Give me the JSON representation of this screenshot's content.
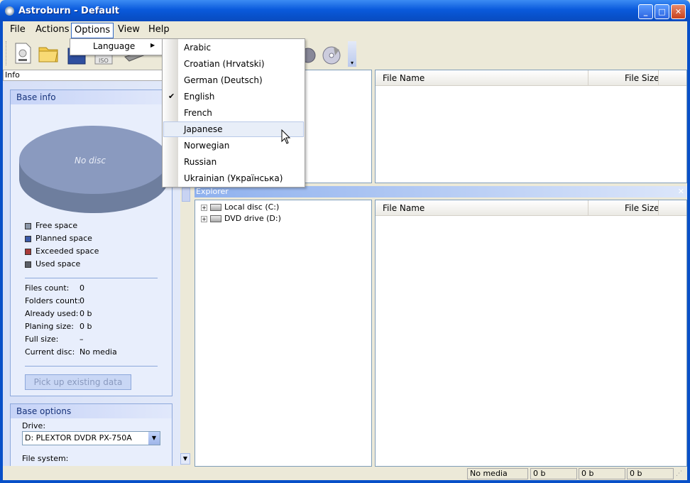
{
  "window": {
    "title": "Astroburn - Default"
  },
  "menubar": [
    "File",
    "Actions",
    "Options",
    "View",
    "Help"
  ],
  "options_menu": {
    "language_label": "Language"
  },
  "language_menu": {
    "items": [
      "Arabic",
      "Croatian (Hrvatski)",
      "German (Deutsch)",
      "English",
      "French",
      "Japanese",
      "Norwegian",
      "Russian",
      "Ukrainian (Українська)"
    ],
    "checked": "English",
    "highlighted": "Japanese"
  },
  "info": {
    "header": "Info",
    "base_info_title": "Base info",
    "no_disc_label": "No disc",
    "legend": [
      {
        "label": "Free space",
        "color": "#8A96A8"
      },
      {
        "label": "Planned space",
        "color": "#3A59A8"
      },
      {
        "label": "Exceeded space",
        "color": "#A83A3A"
      },
      {
        "label": "Used space",
        "color": "#5A5E66"
      }
    ],
    "stats": [
      {
        "label": "Files count:",
        "value": "0"
      },
      {
        "label": "Folders count:",
        "value": "0"
      },
      {
        "label": "Already used:",
        "value": "0 b"
      },
      {
        "label": "Planing size:",
        "value": "0 b"
      },
      {
        "label": "Full size:",
        "value": "–"
      },
      {
        "label": "Current disc:",
        "value": "No media"
      }
    ],
    "pickup_button": "Pick up existing data",
    "base_options_title": "Base options",
    "drive_label": "Drive:",
    "drive_value": "D: PLEXTOR DVDR   PX-750A",
    "filesystem_label": "File system:"
  },
  "project_list": {
    "col_name": "File Name",
    "col_size": "File Size"
  },
  "explorer": {
    "title": "Explorer",
    "tree": [
      {
        "label": "Local disc (C:)"
      },
      {
        "label": "DVD drive (D:)"
      }
    ],
    "col_name": "File Name",
    "col_size": "File Size"
  },
  "statusbar": [
    "No media",
    "0 b",
    "0 b",
    "0 b"
  ],
  "colors": {
    "title_blue": "#0A5ADC",
    "panel_bg": "#E8EEFC",
    "accent_border": "#8DA8DB"
  }
}
